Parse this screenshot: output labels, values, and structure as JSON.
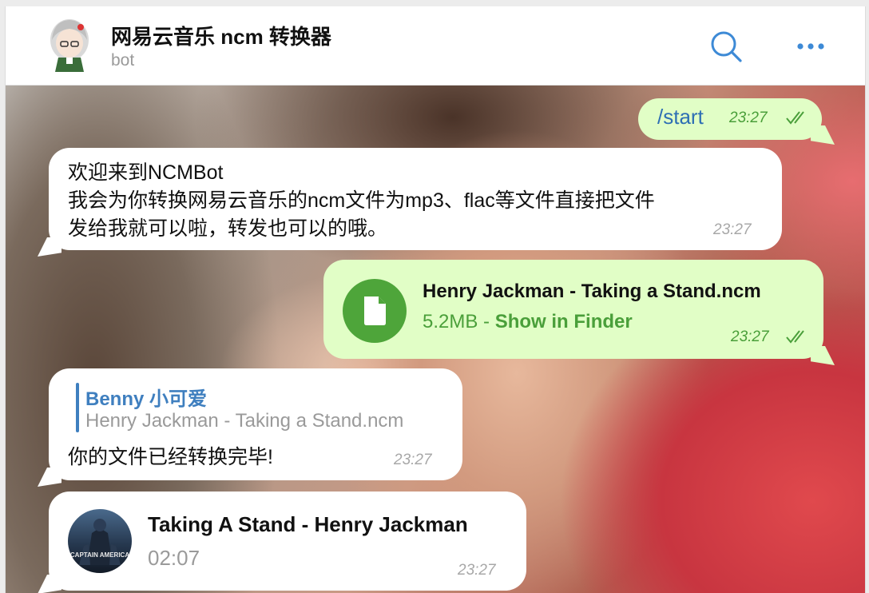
{
  "header": {
    "title": "网易云音乐 ncm 转换器",
    "subtitle": "bot",
    "search_icon": "search-icon",
    "more_icon": "more-dots-icon",
    "accent": "#3d8ad6"
  },
  "messages": {
    "start": {
      "text": "/start",
      "time": "23:27"
    },
    "welcome": {
      "text": "欢迎来到NCMBot\n我会为你转换网易云音乐的ncm文件为mp3、flac等文件直接把文件\n发给我就可以啦，转发也可以的哦。",
      "time": "23:27"
    },
    "file": {
      "name": "Henry Jackman - Taking a Stand.ncm",
      "size": "5.2MB",
      "separator": " - ",
      "action": "Show in Finder",
      "time": "23:27",
      "icon": "document-icon"
    },
    "reply": {
      "author": "Benny 小可爱",
      "quoted": "Henry Jackman - Taking a Stand.ncm",
      "text": "你的文件已经转换完毕!",
      "time": "23:27"
    },
    "audio": {
      "title": "Taking A Stand - Henry Jackman",
      "duration": "02:07",
      "cover_text": "CAPTAIN AMERICA",
      "time": "23:27"
    }
  },
  "colors": {
    "outgoing_bubble": "#e1fec6",
    "incoming_bubble": "#ffffff",
    "outgoing_time": "#4a9f3a",
    "file_icon_bg": "#4ea53a",
    "reply_accent": "#3f7fbf"
  }
}
